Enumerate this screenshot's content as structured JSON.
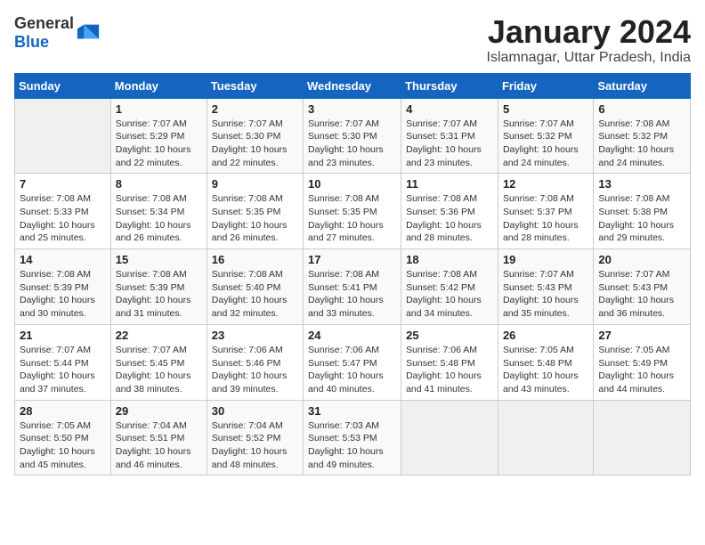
{
  "header": {
    "logo_general": "General",
    "logo_blue": "Blue",
    "month_year": "January 2024",
    "location": "Islamnagar, Uttar Pradesh, India"
  },
  "days_of_week": [
    "Sunday",
    "Monday",
    "Tuesday",
    "Wednesday",
    "Thursday",
    "Friday",
    "Saturday"
  ],
  "weeks": [
    [
      {
        "day": "",
        "info": ""
      },
      {
        "day": "1",
        "info": "Sunrise: 7:07 AM\nSunset: 5:29 PM\nDaylight: 10 hours\nand 22 minutes."
      },
      {
        "day": "2",
        "info": "Sunrise: 7:07 AM\nSunset: 5:30 PM\nDaylight: 10 hours\nand 22 minutes."
      },
      {
        "day": "3",
        "info": "Sunrise: 7:07 AM\nSunset: 5:30 PM\nDaylight: 10 hours\nand 23 minutes."
      },
      {
        "day": "4",
        "info": "Sunrise: 7:07 AM\nSunset: 5:31 PM\nDaylight: 10 hours\nand 23 minutes."
      },
      {
        "day": "5",
        "info": "Sunrise: 7:07 AM\nSunset: 5:32 PM\nDaylight: 10 hours\nand 24 minutes."
      },
      {
        "day": "6",
        "info": "Sunrise: 7:08 AM\nSunset: 5:32 PM\nDaylight: 10 hours\nand 24 minutes."
      }
    ],
    [
      {
        "day": "7",
        "info": "Sunrise: 7:08 AM\nSunset: 5:33 PM\nDaylight: 10 hours\nand 25 minutes."
      },
      {
        "day": "8",
        "info": "Sunrise: 7:08 AM\nSunset: 5:34 PM\nDaylight: 10 hours\nand 26 minutes."
      },
      {
        "day": "9",
        "info": "Sunrise: 7:08 AM\nSunset: 5:35 PM\nDaylight: 10 hours\nand 26 minutes."
      },
      {
        "day": "10",
        "info": "Sunrise: 7:08 AM\nSunset: 5:35 PM\nDaylight: 10 hours\nand 27 minutes."
      },
      {
        "day": "11",
        "info": "Sunrise: 7:08 AM\nSunset: 5:36 PM\nDaylight: 10 hours\nand 28 minutes."
      },
      {
        "day": "12",
        "info": "Sunrise: 7:08 AM\nSunset: 5:37 PM\nDaylight: 10 hours\nand 28 minutes."
      },
      {
        "day": "13",
        "info": "Sunrise: 7:08 AM\nSunset: 5:38 PM\nDaylight: 10 hours\nand 29 minutes."
      }
    ],
    [
      {
        "day": "14",
        "info": "Sunrise: 7:08 AM\nSunset: 5:39 PM\nDaylight: 10 hours\nand 30 minutes."
      },
      {
        "day": "15",
        "info": "Sunrise: 7:08 AM\nSunset: 5:39 PM\nDaylight: 10 hours\nand 31 minutes."
      },
      {
        "day": "16",
        "info": "Sunrise: 7:08 AM\nSunset: 5:40 PM\nDaylight: 10 hours\nand 32 minutes."
      },
      {
        "day": "17",
        "info": "Sunrise: 7:08 AM\nSunset: 5:41 PM\nDaylight: 10 hours\nand 33 minutes."
      },
      {
        "day": "18",
        "info": "Sunrise: 7:08 AM\nSunset: 5:42 PM\nDaylight: 10 hours\nand 34 minutes."
      },
      {
        "day": "19",
        "info": "Sunrise: 7:07 AM\nSunset: 5:43 PM\nDaylight: 10 hours\nand 35 minutes."
      },
      {
        "day": "20",
        "info": "Sunrise: 7:07 AM\nSunset: 5:43 PM\nDaylight: 10 hours\nand 36 minutes."
      }
    ],
    [
      {
        "day": "21",
        "info": "Sunrise: 7:07 AM\nSunset: 5:44 PM\nDaylight: 10 hours\nand 37 minutes."
      },
      {
        "day": "22",
        "info": "Sunrise: 7:07 AM\nSunset: 5:45 PM\nDaylight: 10 hours\nand 38 minutes."
      },
      {
        "day": "23",
        "info": "Sunrise: 7:06 AM\nSunset: 5:46 PM\nDaylight: 10 hours\nand 39 minutes."
      },
      {
        "day": "24",
        "info": "Sunrise: 7:06 AM\nSunset: 5:47 PM\nDaylight: 10 hours\nand 40 minutes."
      },
      {
        "day": "25",
        "info": "Sunrise: 7:06 AM\nSunset: 5:48 PM\nDaylight: 10 hours\nand 41 minutes."
      },
      {
        "day": "26",
        "info": "Sunrise: 7:05 AM\nSunset: 5:48 PM\nDaylight: 10 hours\nand 43 minutes."
      },
      {
        "day": "27",
        "info": "Sunrise: 7:05 AM\nSunset: 5:49 PM\nDaylight: 10 hours\nand 44 minutes."
      }
    ],
    [
      {
        "day": "28",
        "info": "Sunrise: 7:05 AM\nSunset: 5:50 PM\nDaylight: 10 hours\nand 45 minutes."
      },
      {
        "day": "29",
        "info": "Sunrise: 7:04 AM\nSunset: 5:51 PM\nDaylight: 10 hours\nand 46 minutes."
      },
      {
        "day": "30",
        "info": "Sunrise: 7:04 AM\nSunset: 5:52 PM\nDaylight: 10 hours\nand 48 minutes."
      },
      {
        "day": "31",
        "info": "Sunrise: 7:03 AM\nSunset: 5:53 PM\nDaylight: 10 hours\nand 49 minutes."
      },
      {
        "day": "",
        "info": ""
      },
      {
        "day": "",
        "info": ""
      },
      {
        "day": "",
        "info": ""
      }
    ]
  ]
}
